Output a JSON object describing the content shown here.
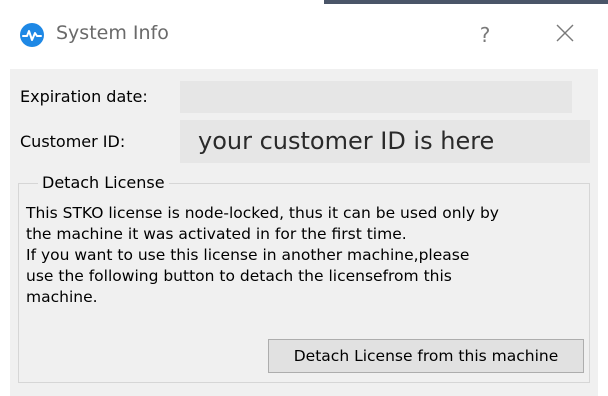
{
  "window": {
    "title": "System Info",
    "help_label": "?",
    "accent_color": "#4a5568"
  },
  "fields": {
    "expiration_label": "Expiration date:",
    "expiration_value": "",
    "customer_id_label": "Customer ID:",
    "customer_id_value": "your customer ID is here"
  },
  "detach_group": {
    "legend": "Detach License",
    "lines": [
      "This STKO license is node-locked, thus it can be used only by",
      "the machine it was activated in for the first time.",
      "If you want to use this license in another machine,please",
      "use the following button to detach the licensefrom this",
      "machine."
    ],
    "button_label": "Detach License from this machine"
  },
  "icons": {
    "app": "heartbeat-icon",
    "close": "close-icon",
    "app_icon_color": "#1e88e5"
  }
}
